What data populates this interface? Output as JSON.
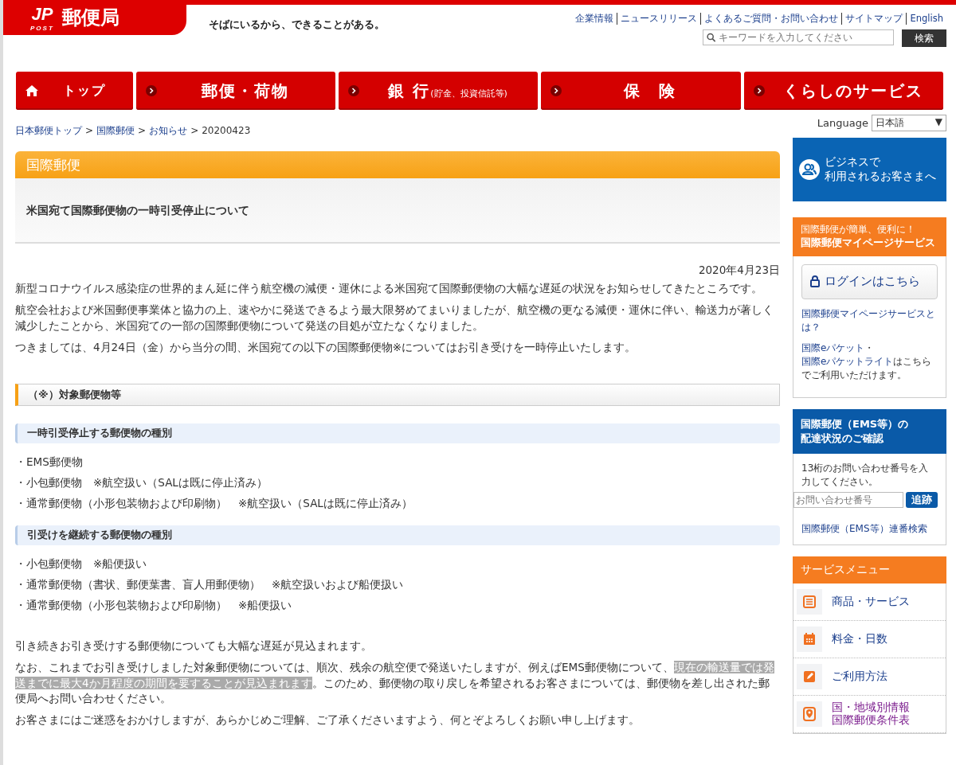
{
  "header": {
    "logo_mark": "JP",
    "logo_sub": "POST",
    "logo_text": "郵便局",
    "tagline": "そばにいるから、できることがある。",
    "links": [
      "企業情報",
      "ニュースリリース",
      "よくあるご質問・お問い合わせ",
      "サイトマップ",
      "English"
    ],
    "search": {
      "placeholder": "キーワードを入力してください",
      "button": "検索"
    }
  },
  "nav": [
    {
      "kind": "home",
      "label": "トップ"
    },
    {
      "kind": "section",
      "label": "郵便・荷物"
    },
    {
      "kind": "section",
      "label": "銀 行",
      "note": "(貯金、投資信託等)"
    },
    {
      "kind": "section",
      "label": "保　険"
    },
    {
      "kind": "section",
      "label": "くらしのサービス"
    }
  ],
  "breadcrumb": {
    "links": [
      "日本郵便トップ",
      "国際郵便",
      "お知らせ"
    ],
    "separator": ">",
    "current": "20200423"
  },
  "language": {
    "label": "Language",
    "value": "日本語",
    "caret": "▼"
  },
  "category_title": "国際郵便",
  "page_title": "米国宛て国際郵便物の一時引受停止について",
  "date": "2020年4月23日",
  "intro": [
    "新型コロナウイルス感染症の世界的まん延に伴う航空機の減便・運休による米国宛て国際郵便物の大幅な遅延の状況をお知らせしてきたところです。",
    "航空会社および米国郵便事業体と協力の上、速やかに発送できるよう最大限努めてまいりましたが、航空機の更なる減便・運休に伴い、輸送力が著しく減少したことから、米国宛ての一部の国際郵便物について発送の目処が立たなくなりました。",
    "つきましては、4月24日（金）から当分の間、米国宛ての以下の国際郵便物※についてはお引き受けを一時停止いたします。"
  ],
  "section_heading": "（※）対象郵便物等",
  "groups": [
    {
      "heading": "一時引受停止する郵便物の種別",
      "items": [
        "・EMS郵便物",
        "・小包郵便物　※航空扱い（SALは既に停止済み）",
        "・通常郵便物（小形包装物および印刷物）　※航空扱い（SALは既に停止済み）"
      ]
    },
    {
      "heading": "引受けを継続する郵便物の種別",
      "items": [
        "・小包郵便物　※船便扱い",
        "・通常郵便物（書状、郵便葉書、盲人用郵便物）　※航空扱いおよび船便扱い",
        "・通常郵便物（小形包装物および印刷物）　※船便扱い"
      ]
    }
  ],
  "closing": [
    {
      "text": "引き続きお引き受けする郵便物についても大幅な遅延が見込まれます。"
    },
    {
      "text": "なお、これまでお引き受けしました対象郵便物については、順次、残余の航空便で発送いたしますが、例えばEMS郵便物について、",
      "highlight": "現在の輸送量では発送までに最大4か月程度の期間を要することが見込まれます",
      "after": "。このため、郵便物の取り戻しを希望されるお客さまについては、郵便物を差し出された郵便局へお問い合わせください。"
    },
    {
      "text": "お客さまにはご迷惑をおかけしますが、あらかじめご理解、ご了承くださいますよう、何とぞよろしくお願い申し上げます。"
    }
  ],
  "sidebar": {
    "business": [
      "ビジネスで",
      "利用されるお客さまへ"
    ],
    "mypage": {
      "small": "国際郵便が簡単、便利に！",
      "title": "国際郵便マイページサービス",
      "login": "ログインはこちら",
      "about": "国際郵便マイページサービスとは？",
      "epacket_1": "国際eパケット",
      "separator": "・",
      "epacket_2": "国際eパケットライト",
      "epacket_rest": "はこちらでご利用いただけます。"
    },
    "tracking": {
      "title": [
        "国際郵便（EMS等）の",
        "配達状況のご確認"
      ],
      "text": "13桁のお問い合わせ番号を入力してください。",
      "placeholder": "お問い合わせ番号",
      "button": "追跡",
      "link": "国際郵便（EMS等）連番検索"
    },
    "service_menu": {
      "title": "サービスメニュー",
      "items": [
        {
          "kind": "list",
          "label": [
            "商品・サービス"
          ],
          "visited": false
        },
        {
          "kind": "calendar",
          "label": [
            "料金・日数"
          ],
          "visited": false
        },
        {
          "kind": "edit",
          "label": [
            "ご利用方法"
          ],
          "visited": false
        },
        {
          "kind": "pin",
          "label": [
            "国・地域別情報",
            "国際郵便条件表"
          ],
          "visited": true
        }
      ]
    }
  }
}
